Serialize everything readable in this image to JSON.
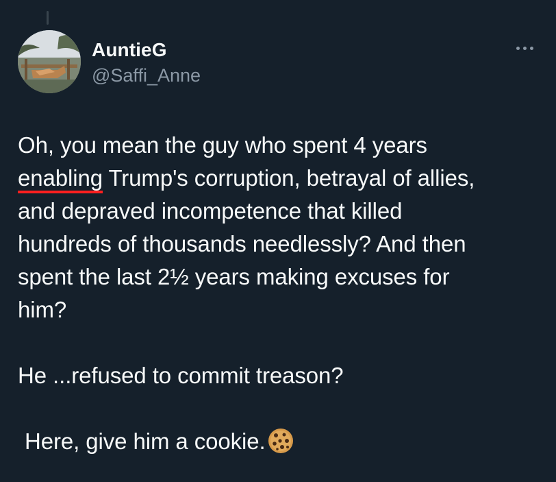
{
  "tweet": {
    "author": {
      "display_name": "AuntieG",
      "handle": "@Saffi_Anne",
      "avatar_icon": "profile-photo-avatar"
    },
    "more_icon": "more-options-icon",
    "body_lines": [
      "Oh, you mean the guy who spent 4 years",
      "enabling",
      " Trump's corruption, betrayal of allies,",
      "and depraved incompetence that killed",
      "hundreds of thousands needlessly? And then",
      "spent the last 2½ years making excuses for",
      "him?",
      "He ...refused to commit treason?",
      "Here, give him a cookie."
    ],
    "emoji_icon": "cookie-icon",
    "spellcheck_color": "#ff1f1f"
  },
  "theme": {
    "background": "#15202b",
    "text": "#f7f9f9",
    "secondary_text": "#8b98a5"
  }
}
